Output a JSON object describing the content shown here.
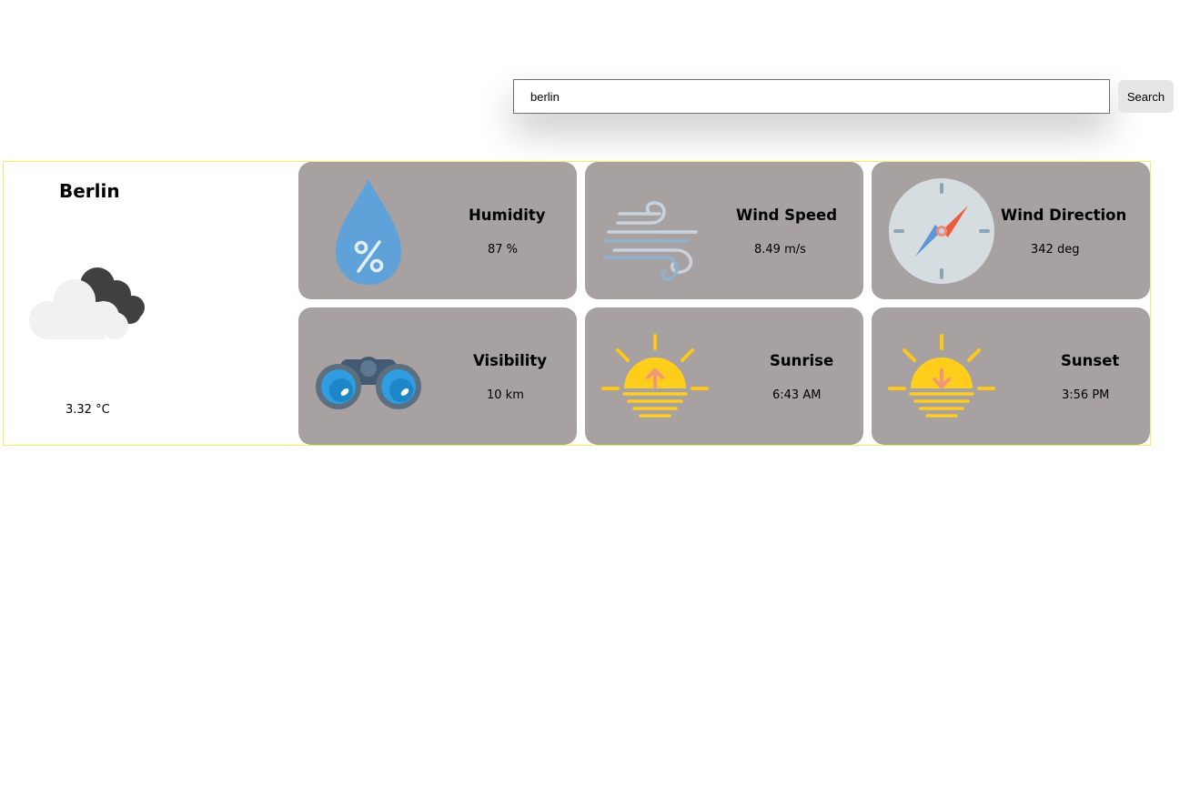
{
  "search": {
    "value": "berlin",
    "button_label": "Search"
  },
  "city": {
    "name": "Berlin",
    "condition_icon": "cloud-icon",
    "temperature": "3.32 °C"
  },
  "cards": [
    {
      "title": "Humidity",
      "value": "87 %",
      "icon": "humidity-drop-icon"
    },
    {
      "title": "Wind Speed",
      "value": "8.49 m/s",
      "icon": "wind-icon"
    },
    {
      "title": "Wind Direction",
      "value": "342 deg",
      "icon": "compass-icon"
    },
    {
      "title": "Visibility",
      "value": "10 km",
      "icon": "binoculars-icon"
    },
    {
      "title": "Sunrise",
      "value": "6:43 AM",
      "icon": "sunrise-icon"
    },
    {
      "title": "Sunset",
      "value": "3:56 PM",
      "icon": "sunset-icon"
    }
  ],
  "colors": {
    "card_background": "#a7a1a1",
    "panel_border": "#f3f05a",
    "search_button": "#e6e6e6"
  }
}
